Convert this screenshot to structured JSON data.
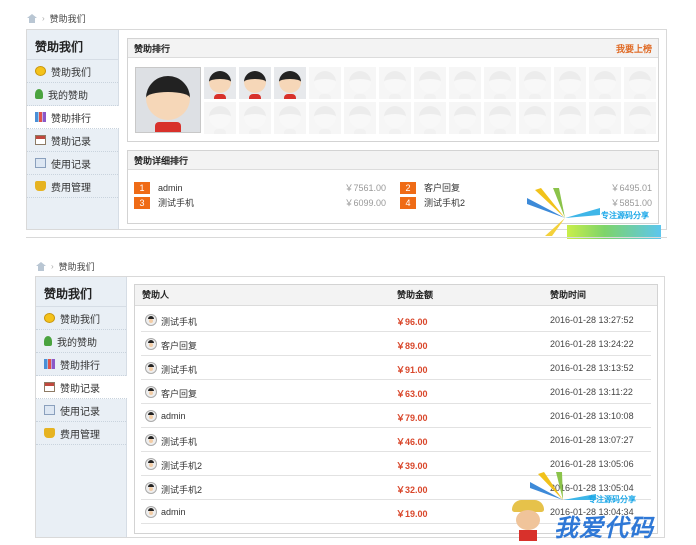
{
  "top": {
    "breadcrumb": "赞助我们",
    "sidebar": {
      "title": "赞助我们",
      "items": [
        {
          "label": "赞助我们",
          "icon": "coin-icon"
        },
        {
          "label": "我的赞助",
          "icon": "user-icon"
        },
        {
          "label": "赞助排行",
          "icon": "bar-chart-icon",
          "active": true
        },
        {
          "label": "赞助记录",
          "icon": "calendar-icon"
        },
        {
          "label": "使用记录",
          "icon": "document-icon"
        },
        {
          "label": "费用管理",
          "icon": "money-icon"
        }
      ]
    },
    "ranking": {
      "title": "赞助排行",
      "action": "我要上榜"
    },
    "detail": {
      "title": "赞助详细排行",
      "rows": [
        {
          "rank": "1",
          "name": "admin",
          "amount": "￥7561.00"
        },
        {
          "rank": "2",
          "name": "客户回复",
          "amount": "￥6495.01"
        },
        {
          "rank": "3",
          "name": "测试手机",
          "amount": "￥6099.00"
        },
        {
          "rank": "4",
          "name": "测试手机2",
          "amount": "￥5851.00"
        }
      ]
    },
    "watermark": "专注源码分享"
  },
  "bottom": {
    "breadcrumb": "赞助我们",
    "sidebar": {
      "title": "赞助我们",
      "items": [
        {
          "label": "赞助我们",
          "icon": "coin-icon"
        },
        {
          "label": "我的赞助",
          "icon": "user-icon"
        },
        {
          "label": "赞助排行",
          "icon": "bar-chart-icon"
        },
        {
          "label": "赞助记录",
          "icon": "calendar-icon",
          "active": true
        },
        {
          "label": "使用记录",
          "icon": "document-icon"
        },
        {
          "label": "费用管理",
          "icon": "money-icon"
        }
      ]
    },
    "table": {
      "headers": [
        "赞助人",
        "赞助金额",
        "赞助时间"
      ],
      "rows": [
        {
          "name": "测试手机",
          "amount": "￥96.00",
          "time": "2016-01-28 13:27:52"
        },
        {
          "name": "客户回复",
          "amount": "￥89.00",
          "time": "2016-01-28 13:24:22"
        },
        {
          "name": "测试手机",
          "amount": "￥91.00",
          "time": "2016-01-28 13:13:52"
        },
        {
          "name": "客户回复",
          "amount": "￥63.00",
          "time": "2016-01-28 13:11:22"
        },
        {
          "name": "admin",
          "amount": "￥79.00",
          "time": "2016-01-28 13:10:08"
        },
        {
          "name": "测试手机",
          "amount": "￥46.00",
          "time": "2016-01-28 13:07:27"
        },
        {
          "name": "测试手机2",
          "amount": "￥39.00",
          "time": "2016-01-28 13:05:06"
        },
        {
          "name": "测试手机2",
          "amount": "￥32.00",
          "time": "2016-01-28 13:05:04"
        },
        {
          "name": "admin",
          "amount": "￥19.00",
          "time": "2016-01-28 13:04:34"
        }
      ]
    },
    "watermark": "专注源码分享",
    "logo_text": "我爱代码"
  }
}
